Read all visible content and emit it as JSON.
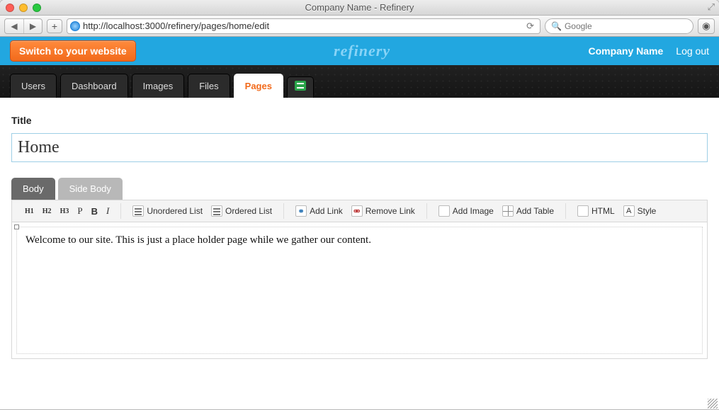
{
  "window": {
    "title": "Company Name - Refinery"
  },
  "browser": {
    "url": "http://localhost:3000/refinery/pages/home/edit",
    "search_placeholder": "Google"
  },
  "topbar": {
    "switch_label": "Switch to your website",
    "brand": "refinery",
    "company_link": "Company Name",
    "logout_link": "Log out"
  },
  "nav": {
    "tabs": [
      {
        "label": "Users"
      },
      {
        "label": "Dashboard"
      },
      {
        "label": "Images"
      },
      {
        "label": "Files"
      },
      {
        "label": "Pages",
        "active": true
      }
    ]
  },
  "form": {
    "title_label": "Title",
    "title_value": "Home"
  },
  "editor_tabs": {
    "body": "Body",
    "side_body": "Side Body"
  },
  "wysiwyg": {
    "h1": "H1",
    "h2": "H2",
    "h3": "H3",
    "p": "P",
    "bold": "B",
    "italic": "I",
    "ul": "Unordered List",
    "ol": "Ordered List",
    "add_link": "Add Link",
    "remove_link": "Remove Link",
    "add_image": "Add Image",
    "add_table": "Add Table",
    "html": "HTML",
    "style": "Style"
  },
  "editor_content": "Welcome to our site. This is just a place holder page while we gather our content."
}
